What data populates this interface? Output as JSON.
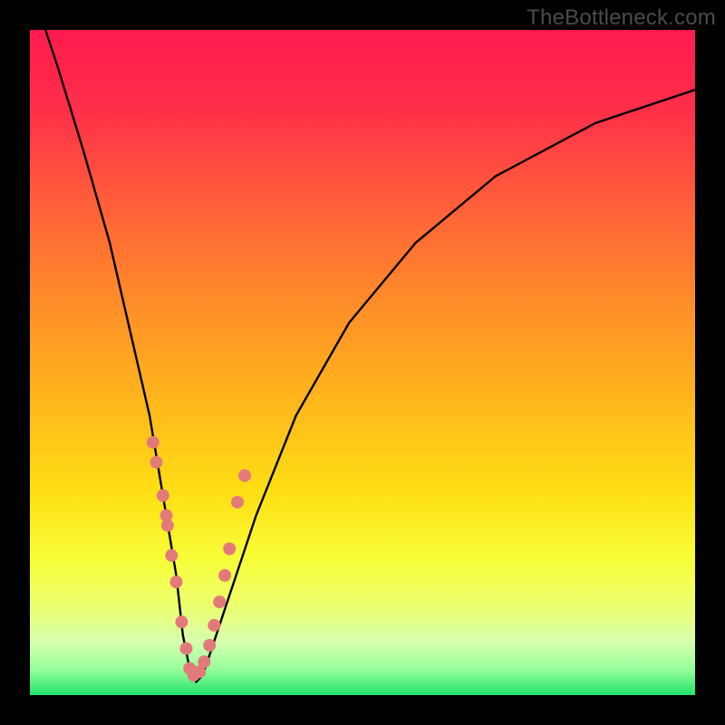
{
  "watermark": {
    "text": "TheBottleneck.com"
  },
  "gradient": {
    "stops": [
      {
        "offset": 0.0,
        "color": "#ff1a4f"
      },
      {
        "offset": 0.12,
        "color": "#ff2f49"
      },
      {
        "offset": 0.25,
        "color": "#ff5b3b"
      },
      {
        "offset": 0.4,
        "color": "#ff8a2a"
      },
      {
        "offset": 0.55,
        "color": "#ffb41c"
      },
      {
        "offset": 0.7,
        "color": "#ffe015"
      },
      {
        "offset": 0.8,
        "color": "#f7ff3a"
      },
      {
        "offset": 0.87,
        "color": "#ecff74"
      },
      {
        "offset": 0.92,
        "color": "#d6ffaf"
      },
      {
        "offset": 0.96,
        "color": "#9aff9a"
      },
      {
        "offset": 1.0,
        "color": "#22e36b"
      }
    ]
  },
  "chart_data": {
    "type": "line",
    "title": "",
    "xlabel": "",
    "ylabel": "",
    "xlim": [
      0,
      100
    ],
    "ylim": [
      0,
      100
    ],
    "grid": false,
    "series": [
      {
        "name": "bottleneck-curve",
        "x": [
          0,
          4,
          8,
          12,
          15,
          18,
          20,
          22,
          23,
          24,
          25,
          26,
          27,
          30,
          34,
          40,
          48,
          58,
          70,
          85,
          100
        ],
        "values": [
          107,
          95,
          82,
          68,
          55,
          42,
          30,
          18,
          9,
          4,
          2,
          3,
          6,
          15,
          27,
          42,
          56,
          68,
          78,
          86,
          91
        ]
      }
    ],
    "scatter": {
      "name": "sample-points",
      "color": "#e37a7a",
      "x": [
        18.5,
        19.0,
        20.0,
        20.5,
        20.7,
        21.3,
        22.0,
        22.8,
        23.5,
        24.0,
        24.6,
        25.5,
        26.2,
        27.0,
        27.7,
        28.5,
        29.3,
        30.0,
        31.2,
        32.3
      ],
      "values": [
        38.0,
        35.0,
        30.0,
        27.0,
        25.5,
        21.0,
        17.0,
        11.0,
        7.0,
        4.0,
        3.0,
        3.5,
        5.0,
        7.5,
        10.5,
        14.0,
        18.0,
        22.0,
        29.0,
        33.0
      ]
    }
  }
}
